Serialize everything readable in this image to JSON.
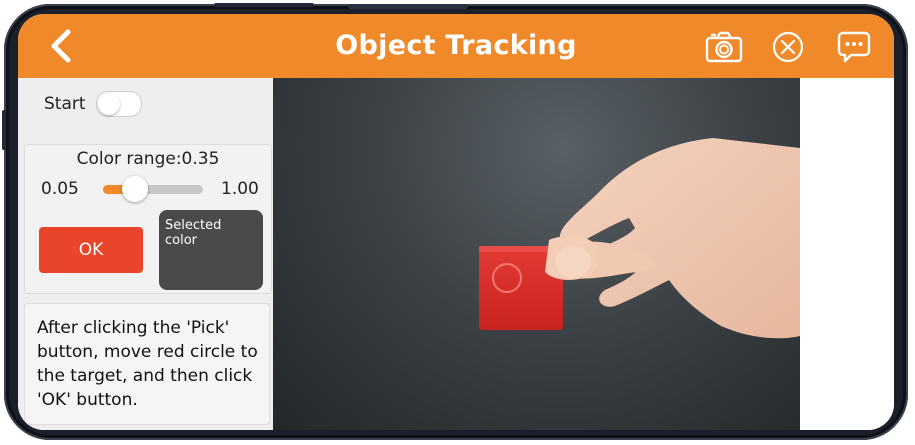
{
  "header": {
    "title": "Object Tracking",
    "bar_color": "#f0892a",
    "icons": [
      "back-arrow-icon",
      "camera-icon",
      "close-circle-icon",
      "chat-bubble-icon"
    ]
  },
  "controls": {
    "start_label": "Start",
    "start_on": false,
    "color_range_label": "Color range:0.35",
    "range_min": "0.05",
    "range_max": "1.00",
    "range_value": 0.35,
    "ok_label": "OK",
    "selected_color_label": "Selected color",
    "selected_color": "#4a4a4a"
  },
  "instructions": "After clicking the 'Pick' button, move red circle to the target, and then click 'OK' button."
}
